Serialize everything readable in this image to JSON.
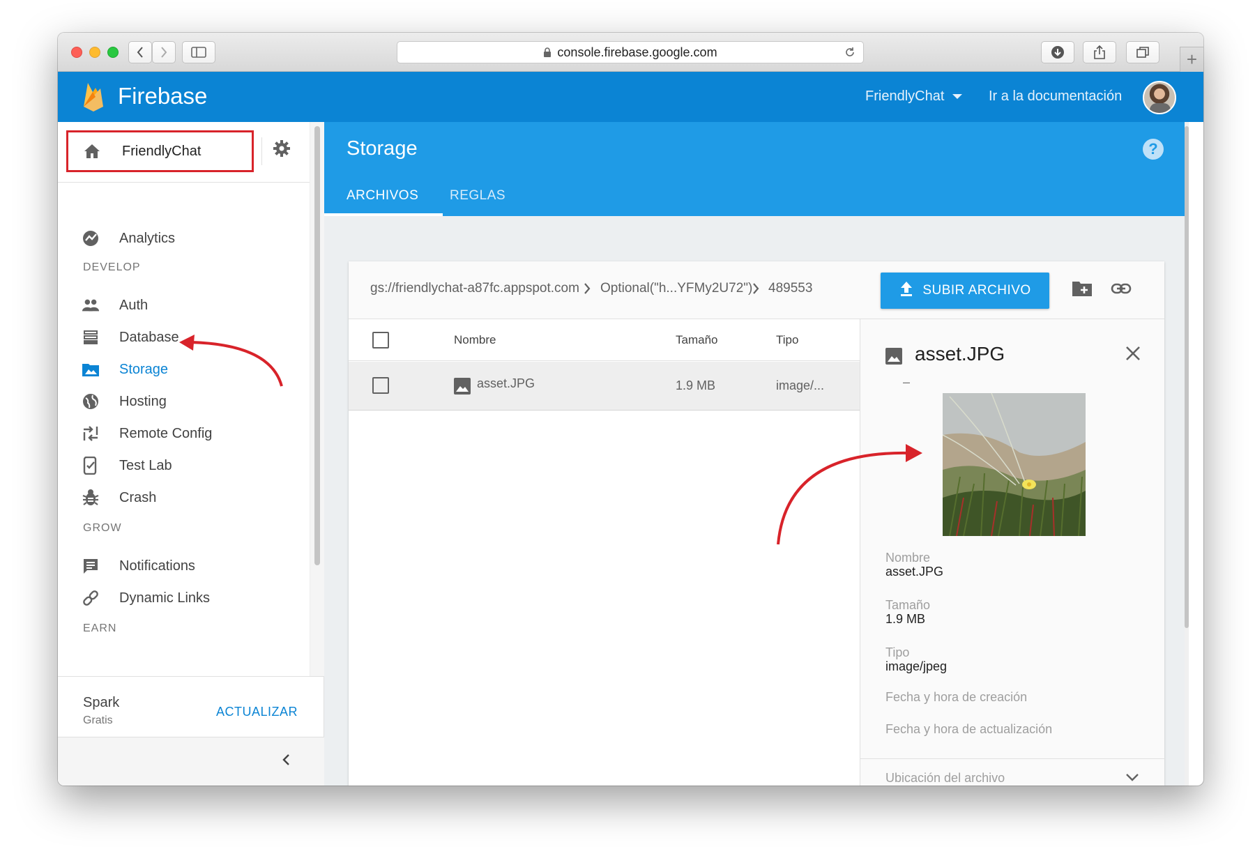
{
  "browser": {
    "url": "console.firebase.google.com",
    "new_tab": "+"
  },
  "header": {
    "brand": "Firebase",
    "project": "FriendlyChat",
    "docs_link": "Ir a la documentación"
  },
  "sidebar": {
    "project": "FriendlyChat",
    "top_item": {
      "label": "Analytics",
      "icon": "analytics-icon"
    },
    "sections": {
      "develop": "DEVELOP",
      "grow": "GROW",
      "earn": "EARN"
    },
    "develop_items": [
      {
        "label": "Auth",
        "icon": "people-icon"
      },
      {
        "label": "Database",
        "icon": "database-icon"
      },
      {
        "label": "Storage",
        "icon": "storage-icon"
      },
      {
        "label": "Hosting",
        "icon": "globe-icon"
      },
      {
        "label": "Remote Config",
        "icon": "remote-config-icon"
      },
      {
        "label": "Test Lab",
        "icon": "test-lab-icon"
      },
      {
        "label": "Crash",
        "icon": "bug-icon"
      }
    ],
    "grow_items": [
      {
        "label": "Notifications",
        "icon": "message-icon"
      },
      {
        "label": "Dynamic Links",
        "icon": "link-icon"
      }
    ],
    "plan": {
      "name": "Spark",
      "tier": "Gratis",
      "action": "ACTUALIZAR"
    }
  },
  "page": {
    "title": "Storage",
    "tabs": [
      "ARCHIVOS",
      "REGLAS"
    ],
    "active_tab": "ARCHIVOS"
  },
  "storage": {
    "path": [
      "gs://friendlychat-a87fc.appspot.com",
      "Optional(\"h...YFMy2U72\")",
      "489553"
    ],
    "upload_label": "SUBIR ARCHIVO",
    "columns": [
      "Nombre",
      "Tamaño",
      "Tipo"
    ],
    "rows": [
      {
        "name": "asset.JPG",
        "size": "1.9 MB",
        "type": "image/..."
      }
    ]
  },
  "detail": {
    "title": "asset.JPG",
    "dash": "–",
    "fields": [
      {
        "label": "Nombre",
        "value": "asset.JPG"
      },
      {
        "label": "Tamaño",
        "value": "1.9 MB"
      },
      {
        "label": "Tipo",
        "value": "image/jpeg"
      }
    ],
    "created_label": "Fecha y hora de creación",
    "updated_label": "Fecha y hora de actualización",
    "location_label": "Ubicación del archivo"
  },
  "colors": {
    "header_blue": "#0b84d4",
    "page_blue": "#1f9be6",
    "annotation_red": "#d8232a"
  }
}
